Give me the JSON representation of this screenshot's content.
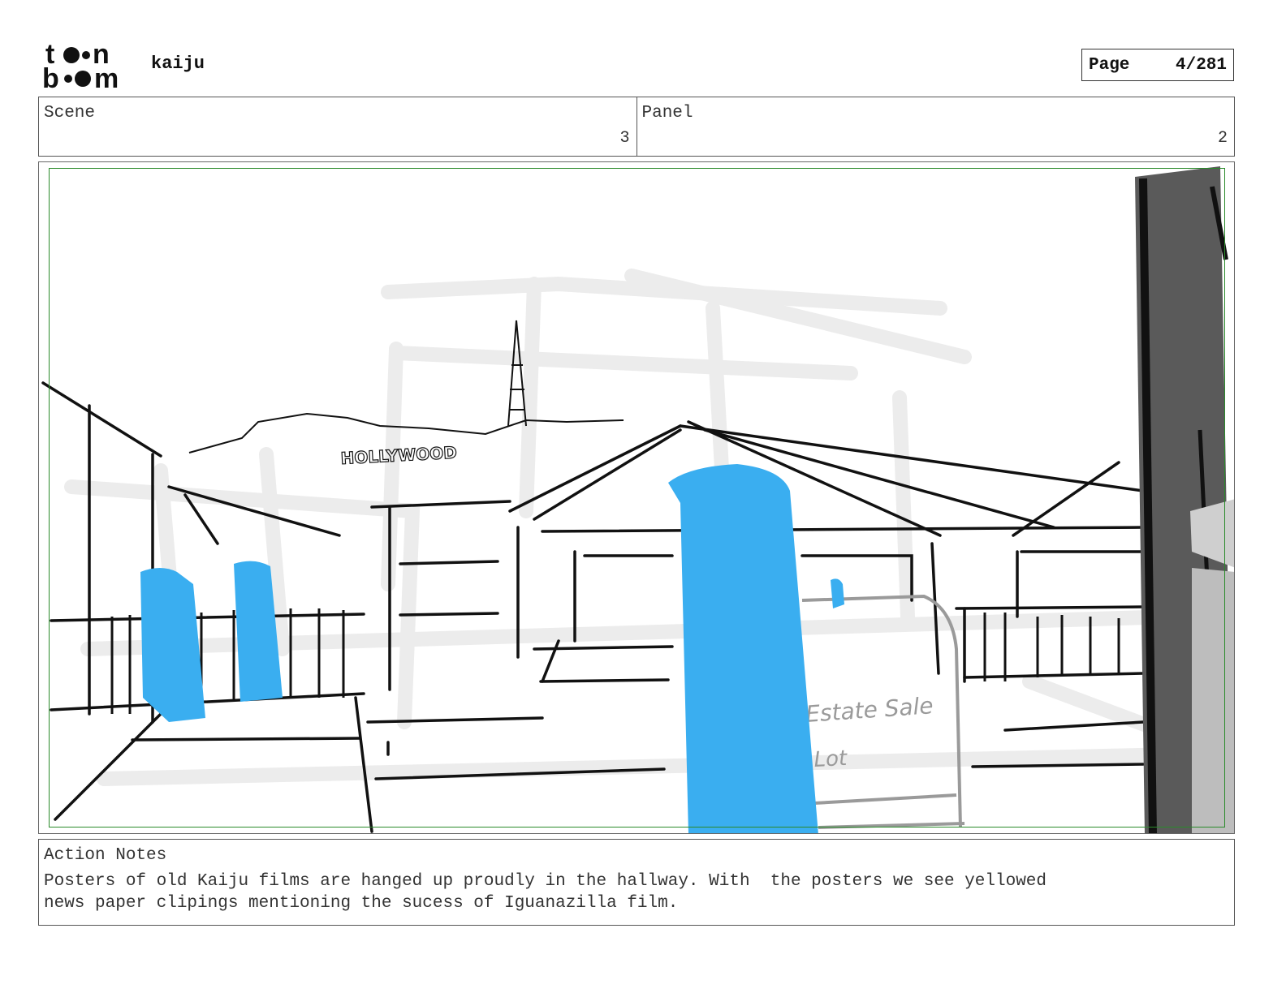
{
  "header": {
    "logo_text": "toon boom",
    "project_title": "kaiju",
    "page_label": "Page",
    "page_value": "4/281"
  },
  "info": {
    "scene_label": "Scene",
    "scene_value": "3",
    "panel_label": "Panel",
    "panel_value": "2"
  },
  "panel": {
    "sketch_sign_text": "HOLLYWOOD",
    "sketch_handwriting": [
      "Estate Sale",
      "Lot"
    ],
    "colors": {
      "figure_blue": "#3aaef0",
      "safe_area_green": "#2a8a2a",
      "pillar_dark": "#5a5a5a",
      "sketch_ghost": "#ececec"
    }
  },
  "notes": {
    "label": "Action Notes",
    "text": "Posters of old Kaiju films are hanged up proudly in the hallway. With  the posters we see yellowed\nnews paper clipings mentioning the sucess of Iguanazilla film."
  }
}
